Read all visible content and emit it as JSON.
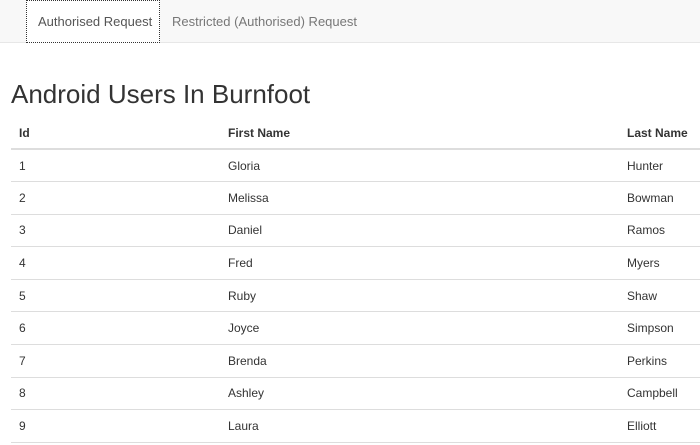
{
  "nav": {
    "tabs": [
      {
        "label": "Authorised Request",
        "active": true
      },
      {
        "label": "Restricted (Authorised) Request",
        "active": false
      }
    ]
  },
  "page": {
    "title": "Android Users In Burnfoot"
  },
  "table": {
    "headers": {
      "id": "Id",
      "first_name": "First Name",
      "last_name": "Last Name"
    },
    "rows": [
      {
        "id": "1",
        "first_name": "Gloria",
        "last_name": "Hunter"
      },
      {
        "id": "2",
        "first_name": "Melissa",
        "last_name": "Bowman"
      },
      {
        "id": "3",
        "first_name": "Daniel",
        "last_name": "Ramos"
      },
      {
        "id": "4",
        "first_name": "Fred",
        "last_name": "Myers"
      },
      {
        "id": "5",
        "first_name": "Ruby",
        "last_name": "Shaw"
      },
      {
        "id": "6",
        "first_name": "Joyce",
        "last_name": "Simpson"
      },
      {
        "id": "7",
        "first_name": "Brenda",
        "last_name": "Perkins"
      },
      {
        "id": "8",
        "first_name": "Ashley",
        "last_name": "Campbell"
      },
      {
        "id": "9",
        "first_name": "Laura",
        "last_name": "Elliott"
      }
    ]
  }
}
